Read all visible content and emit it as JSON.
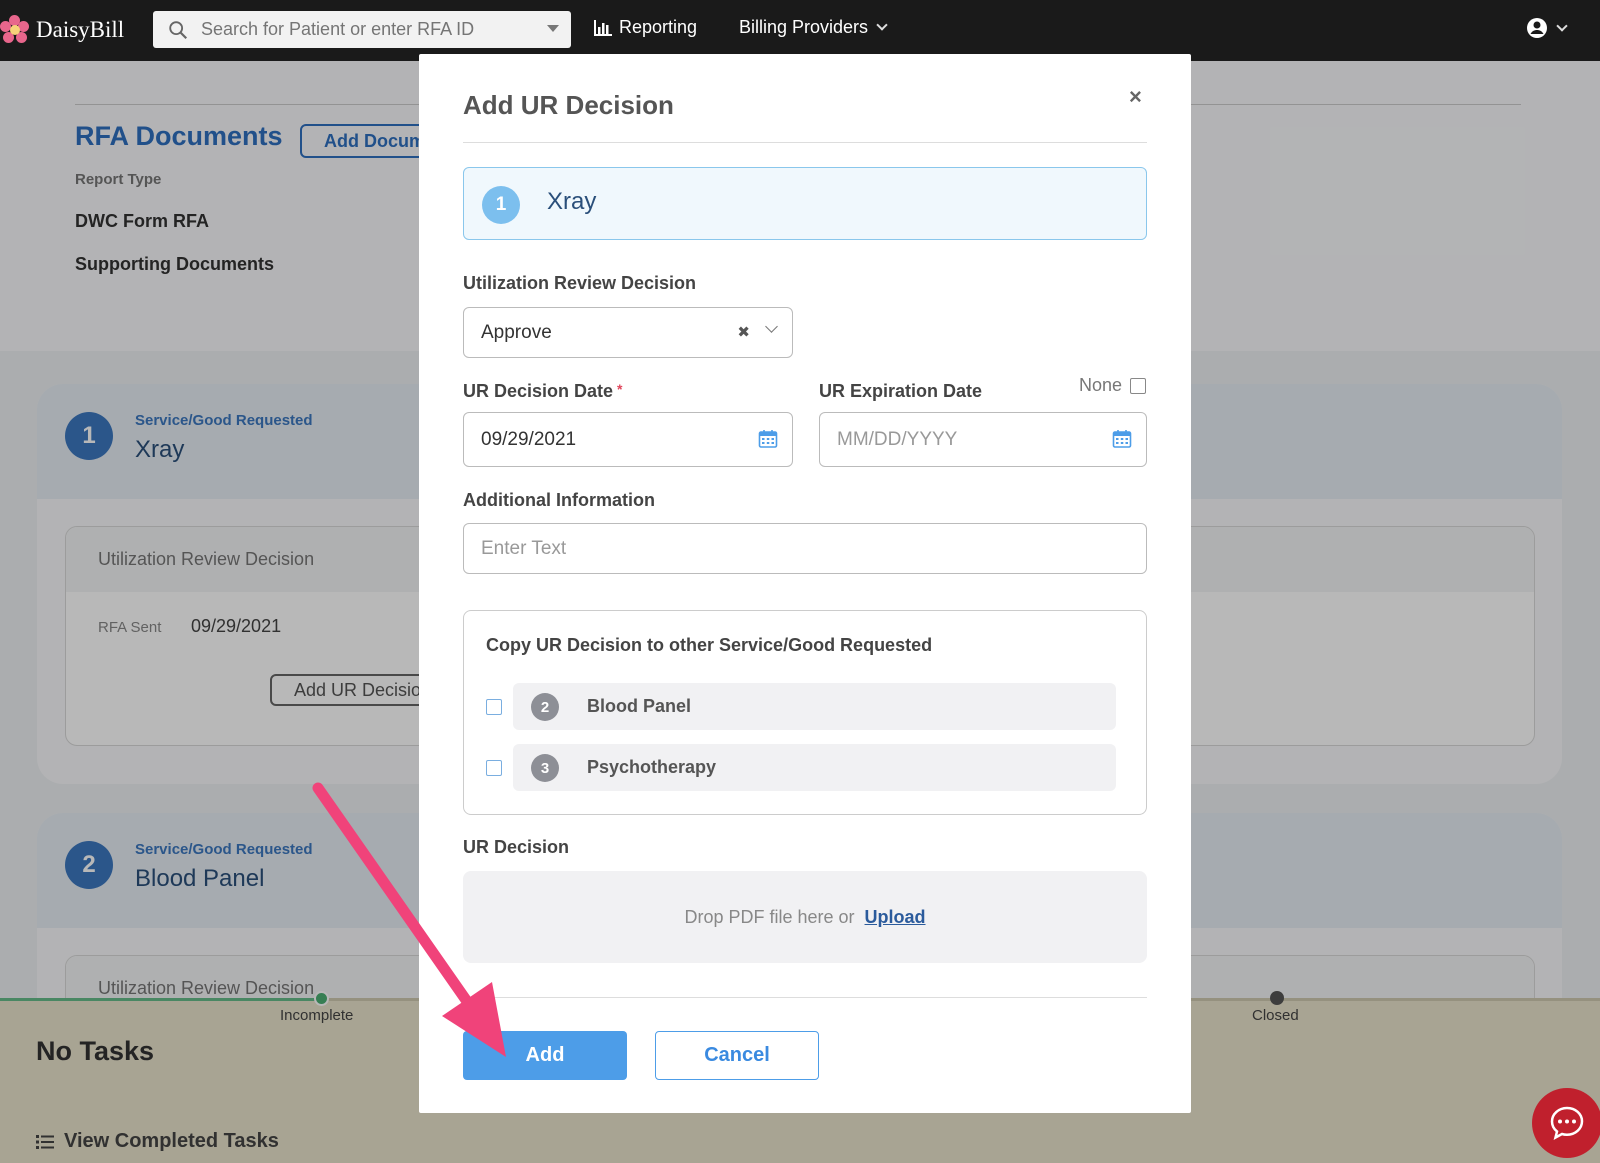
{
  "nav": {
    "brand": "DaisyBill",
    "search_placeholder": "Search for Patient or enter RFA ID",
    "reporting": "Reporting",
    "billing_providers": "Billing Providers"
  },
  "background": {
    "rfa_documents_title": "RFA Documents",
    "add_document_button": "Add Document",
    "report_type_label": "Report Type",
    "report_types": [
      "DWC Form RFA",
      "Supporting Documents"
    ],
    "services": [
      {
        "number": "1",
        "label": "Service/Good Requested",
        "name": "Xray"
      },
      {
        "number": "2",
        "label": "Service/Good Requested",
        "name": "Blood Panel"
      }
    ],
    "urd_box_title": "Utilization Review Decision",
    "urd_box_title_2": "Utilization Review Decision",
    "rfa_sent_label": "RFA Sent",
    "rfa_sent_value": "09/29/2021",
    "add_ur_button": "Add UR Decision",
    "progress_incomplete": "Incomplete",
    "progress_closed": "Closed",
    "no_tasks": "No Tasks",
    "view_completed": "View Completed Tasks"
  },
  "modal": {
    "title": "Add UR Decision",
    "close": "×",
    "service": {
      "number": "1",
      "name": "Xray"
    },
    "ur_decision_label": "Utilization Review Decision",
    "ur_decision_value": "Approve",
    "ur_decision_date_label": "UR Decision Date",
    "required_mark": "*",
    "ur_decision_date_value": "09/29/2021",
    "ur_expiration_label": "UR Expiration Date",
    "none_label": "None",
    "ur_expiration_placeholder": "MM/DD/YYYY",
    "additional_info_label": "Additional Information",
    "additional_info_placeholder": "Enter Text",
    "copy_title": "Copy UR Decision to other Service/Good Requested",
    "copy_items": [
      {
        "number": "2",
        "name": "Blood Panel"
      },
      {
        "number": "3",
        "name": "Psychotherapy"
      }
    ],
    "ur_decision_file_label": "UR Decision",
    "drop_text": "Drop PDF file here or",
    "upload_link": "Upload",
    "add_button": "Add",
    "cancel_button": "Cancel"
  }
}
